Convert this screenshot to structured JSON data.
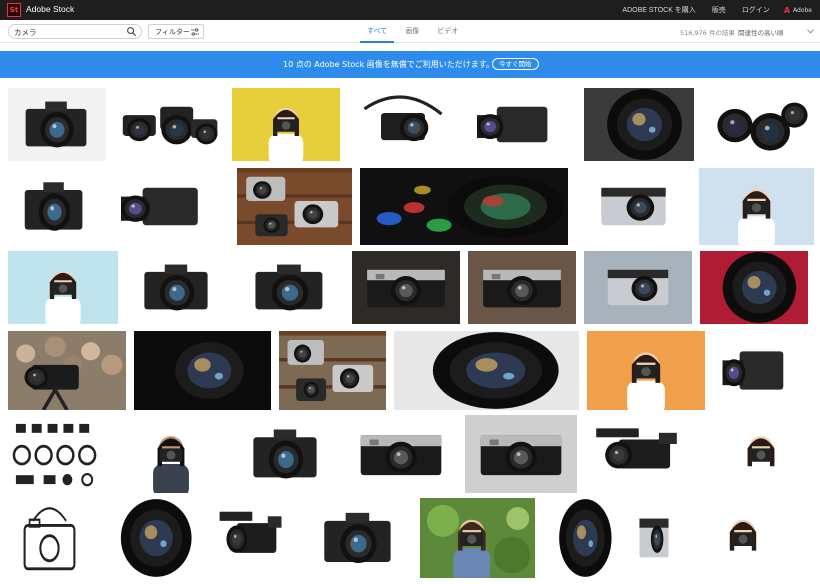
{
  "topbar": {
    "brand_logo": "St",
    "brand_name": "Adobe Stock",
    "links": [
      "ADOBE STOCK を購入",
      "販売",
      "ログイン"
    ],
    "adobe_label": "Adobe"
  },
  "search": {
    "query": "カメラ",
    "filter_label": "フィルター"
  },
  "tabs": [
    {
      "label": "すべて",
      "active": true
    },
    {
      "label": "画像",
      "active": false
    },
    {
      "label": "ビデオ",
      "active": false
    }
  ],
  "results_text": "516,976 件の結果",
  "sort_label": "関連性の高い順",
  "banner": {
    "text": "10 点の Adobe Stock 画像を無償でご利用いただけます。",
    "button": "今すぐ開始"
  },
  "image_grid": {
    "rows": [
      [
        {
          "subject": "dslr-camera",
          "bg": "#f2f2f2"
        },
        {
          "subject": "camera-collection",
          "bg": "#ffffff"
        },
        {
          "subject": "woman-with-camera",
          "bg": "#e6cf3a"
        },
        {
          "subject": "camera-with-strap",
          "bg": "#ffffff"
        },
        {
          "subject": "dslr-side",
          "bg": "#ffffff"
        },
        {
          "subject": "lens-closeup",
          "bg": "#3b3b3b"
        },
        {
          "subject": "camera-lenses",
          "bg": "#ffffff"
        }
      ],
      [
        {
          "subject": "dslr-camera",
          "bg": "#ffffff"
        },
        {
          "subject": "dslr-side",
          "bg": "#ffffff"
        },
        {
          "subject": "vintage-cameras-wood",
          "bg": "#7a4a2c"
        },
        {
          "subject": "lens-bokeh",
          "bg": "#101010"
        },
        {
          "subject": "compact-camera",
          "bg": "#ffffff"
        },
        {
          "subject": "woman-with-camera",
          "bg": "#cfe0ee"
        }
      ],
      [
        {
          "subject": "woman-with-camera",
          "bg": "#bfe4ee"
        },
        {
          "subject": "dslr-camera",
          "bg": "#ffffff"
        },
        {
          "subject": "dslr-camera",
          "bg": "#ffffff"
        },
        {
          "subject": "vintage-camera",
          "bg": "#2e2a25"
        },
        {
          "subject": "vintage-camera",
          "bg": "#6a5647"
        },
        {
          "subject": "compact-camera",
          "bg": "#a7b2bd"
        },
        {
          "subject": "lens-closeup",
          "bg": "#b01c33"
        }
      ],
      [
        {
          "subject": "video-camera-crowd",
          "bg": "#8c7c6a"
        },
        {
          "subject": "lens-closeup",
          "bg": "#0c0c0c"
        },
        {
          "subject": "vintage-cameras-wood",
          "bg": "#7d6a55"
        },
        {
          "subject": "lens-closeup",
          "bg": "#e7e7e7"
        },
        {
          "subject": "woman-with-camera",
          "bg": "#f0a04a"
        },
        {
          "subject": "dslr-side",
          "bg": "#ffffff"
        }
      ],
      [
        {
          "subject": "camera-icons",
          "bg": "#ffffff"
        },
        {
          "subject": "man-with-camera",
          "bg": "#ffffff"
        },
        {
          "subject": "dslr-camera",
          "bg": "#ffffff"
        },
        {
          "subject": "vintage-camera",
          "bg": "#ffffff"
        },
        {
          "subject": "vintage-camera",
          "bg": "#cfcfcf"
        },
        {
          "subject": "video-camera",
          "bg": "#ffffff"
        },
        {
          "subject": "woman-with-camera",
          "bg": "#ffffff"
        }
      ],
      [
        {
          "subject": "camera-outline-icon",
          "bg": "#ffffff"
        },
        {
          "subject": "lens-closeup",
          "bg": "#ffffff"
        },
        {
          "subject": "video-camera",
          "bg": "#ffffff"
        },
        {
          "subject": "dslr-camera",
          "bg": "#ffffff"
        },
        {
          "subject": "woman-in-garden",
          "bg": "#5d8a3a"
        },
        {
          "subject": "lens-closeup",
          "bg": "#ffffff"
        },
        {
          "subject": "compact-camera",
          "bg": "#ffffff"
        },
        {
          "subject": "woman-with-camera",
          "bg": "#ffffff"
        }
      ]
    ]
  },
  "colors": {
    "accent": "#2d8ceb",
    "tab_active": "#2d7ee6",
    "topbar": "#1e1e1e"
  }
}
